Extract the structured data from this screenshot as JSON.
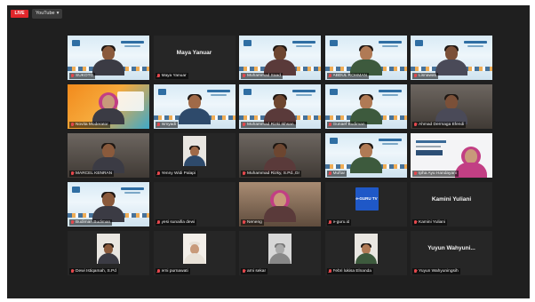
{
  "topbar": {
    "live_badge": "LIVE",
    "stream_target": "YouTube",
    "dropdown_glyph": "▾"
  },
  "participants": [
    {
      "id": "p1",
      "label": "SUKOTO",
      "video": "banner-person"
    },
    {
      "id": "p2",
      "label": "Maya Yanuar",
      "card_name": "Maya Yanuar",
      "video": "off"
    },
    {
      "id": "p3",
      "label": "Muhammad Saad",
      "video": "banner-person"
    },
    {
      "id": "p4",
      "label": "ABDUL ROHMAN",
      "video": "banner-person"
    },
    {
      "id": "p5",
      "label": "Lisnawati",
      "video": "banner-person"
    },
    {
      "id": "p6",
      "label": "Novita Moderator",
      "video": "orange-person"
    },
    {
      "id": "p7",
      "label": "Ismyadi",
      "video": "banner-person"
    },
    {
      "id": "p8",
      "label": "Muhammad Rizki Ikhsan",
      "video": "banner-person"
    },
    {
      "id": "p9",
      "label": "Gunaef Budiman",
      "video": "banner-person"
    },
    {
      "id": "p10",
      "label": "Ahmad Dermaga Efendi",
      "video": "room-person"
    },
    {
      "id": "p11",
      "label": "MARCEL KENRAN",
      "video": "room-person"
    },
    {
      "id": "p12",
      "label": "Yenny Widi Palapi",
      "video": "photo"
    },
    {
      "id": "p13",
      "label": "Muhammad Rizky, S.Pd.,Gr",
      "video": "room-person"
    },
    {
      "id": "p14",
      "label": "Muftar",
      "video": "banner-person"
    },
    {
      "id": "p15",
      "label": "Ipha Ayu Handayani",
      "video": "flyer"
    },
    {
      "id": "p16",
      "label": "Budiman Budiman",
      "video": "banner-person"
    },
    {
      "id": "p17",
      "label": "yesi sunaifia dewi",
      "video": "off"
    },
    {
      "id": "p18",
      "label": "Neneng",
      "video": "room-hijab"
    },
    {
      "id": "p19",
      "label": "e-guru.id",
      "video": "tv-logo"
    },
    {
      "id": "p20",
      "label": "Kamini Yuliani",
      "card_name": "Kamini Yuliani",
      "video": "off"
    },
    {
      "id": "p21",
      "label": "Dewi Istiqamah, S.Pd",
      "video": "photo"
    },
    {
      "id": "p22",
      "label": "erni purnawati",
      "video": "photo-hijab"
    },
    {
      "id": "p23",
      "label": "arni sekar",
      "video": "photo-gray"
    },
    {
      "id": "p24",
      "label": "Febri lukisa Elnanda",
      "video": "photo"
    },
    {
      "id": "p25",
      "label": "Yuyun Wahyuningsih",
      "card_name": "Yuyun Wahyuni...",
      "video": "off"
    }
  ],
  "tv_logo_text": "e-GURU TV",
  "colors": {
    "live": "#e0262b",
    "mic_muted": "#e5484d",
    "background": "#1f1f1f"
  }
}
